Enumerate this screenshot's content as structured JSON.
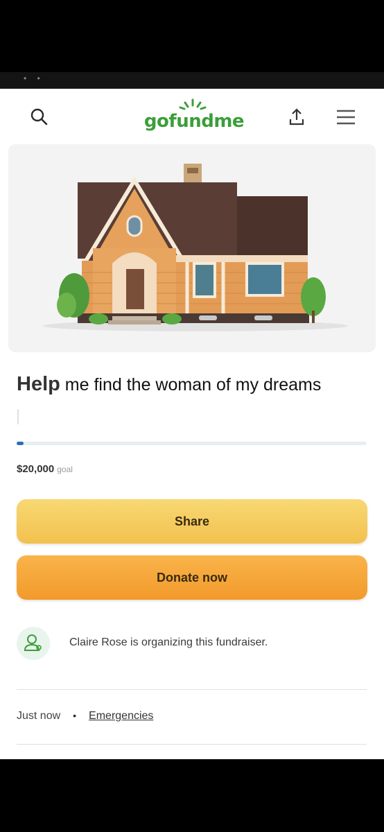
{
  "header": {
    "logo_text": "gofundme",
    "brand_color": "#3c9e3a",
    "icons": [
      "search-icon",
      "upload-share-icon",
      "hamburger-menu-icon"
    ]
  },
  "hero": {
    "image": "house-illustration"
  },
  "campaign": {
    "title_bold": "Help",
    "title_rest": " me find the woman of my dreams",
    "progress_fraction": 0.004,
    "goal_amount": "$20,000",
    "goal_label": "goal"
  },
  "actions": {
    "share_label": "Share",
    "donate_label": "Donate now"
  },
  "organizer": {
    "text": "Claire Rose is organizing this fundraiser."
  },
  "meta": {
    "time": "Just now",
    "separator": "•",
    "category": "Emergencies"
  },
  "colors": {
    "share_button": "#f2c14e",
    "donate_button": "#f29a2b",
    "progress": "#2b6fb0"
  }
}
